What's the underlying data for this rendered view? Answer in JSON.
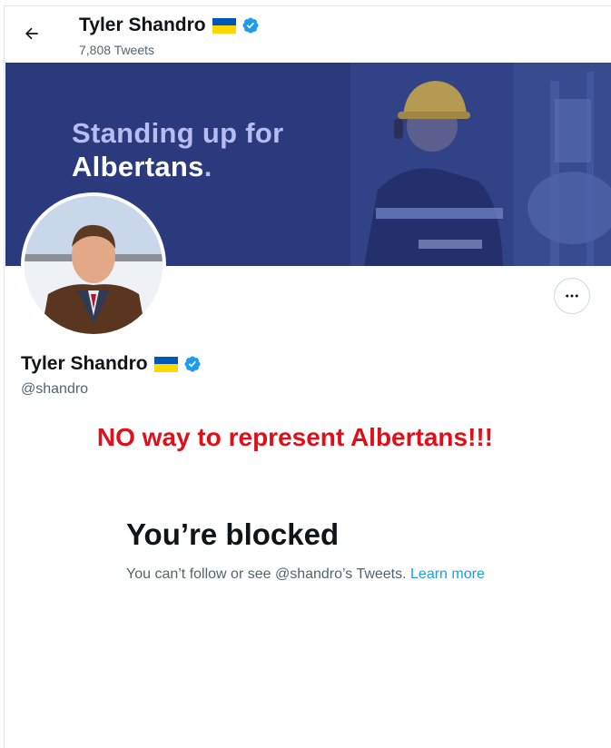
{
  "header": {
    "name": "Tyler Shandro",
    "tweet_count": "7,808 Tweets"
  },
  "banner": {
    "line1": "Standing up for",
    "line2": "Albertans",
    "line2_dot": "."
  },
  "profile": {
    "name": "Tyler Shandro",
    "handle": "@shandro"
  },
  "annotation": {
    "text": "NO way to represent Albertans!!!",
    "color": "#e0101b"
  },
  "blocked": {
    "title": "You’re blocked",
    "body": "You can’t follow or see @shandro’s Tweets.",
    "link_label": "Learn more"
  },
  "colors": {
    "banner_bg": "#2a3a7c",
    "verified": "#1d9bf0",
    "flag_blue": "#0057b7",
    "flag_yellow": "#ffd700",
    "link": "#1d9bf0"
  },
  "icons": {
    "back": "arrow-left-icon",
    "verified": "verified-badge-icon",
    "flag": "ukraine-flag-icon",
    "more": "more-horizontal-icon"
  }
}
